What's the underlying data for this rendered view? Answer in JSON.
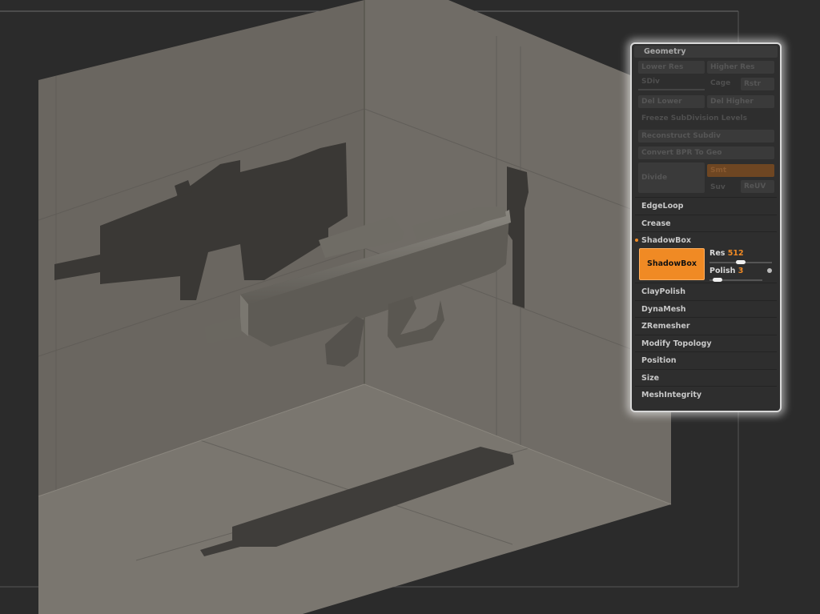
{
  "panel": {
    "header": "Geometry",
    "dim_buttons": {
      "lower_res": "Lower Res",
      "higher_res": "Higher Res",
      "sdiv": "SDiv",
      "cage": "Cage",
      "rstr": "Rstr",
      "del_lower": "Del Lower",
      "del_higher": "Del Higher",
      "freeze": "Freeze SubDivision Levels",
      "reconstruct": "Reconstruct Subdiv",
      "convert_bpr": "Convert BPR To Geo",
      "divide": "Divide",
      "smt": "Smt",
      "suv": "Suv",
      "reuv": "ReUV"
    },
    "sections": {
      "edgeloop": "EdgeLoop",
      "crease": "Crease",
      "shadowbox": "ShadowBox",
      "claypolish": "ClayPolish",
      "dynamesh": "DynaMesh",
      "zremesher": "ZRemesher",
      "modify_topology": "Modify Topology",
      "position": "Position",
      "size": "Size",
      "meshintegrity": "MeshIntegrity"
    },
    "shadowbox_button": "ShadowBox",
    "res": {
      "label": "Res",
      "value": "512",
      "fraction": 0.5
    },
    "polish": {
      "label": "Polish",
      "value": "3",
      "fraction": 0.08
    }
  }
}
